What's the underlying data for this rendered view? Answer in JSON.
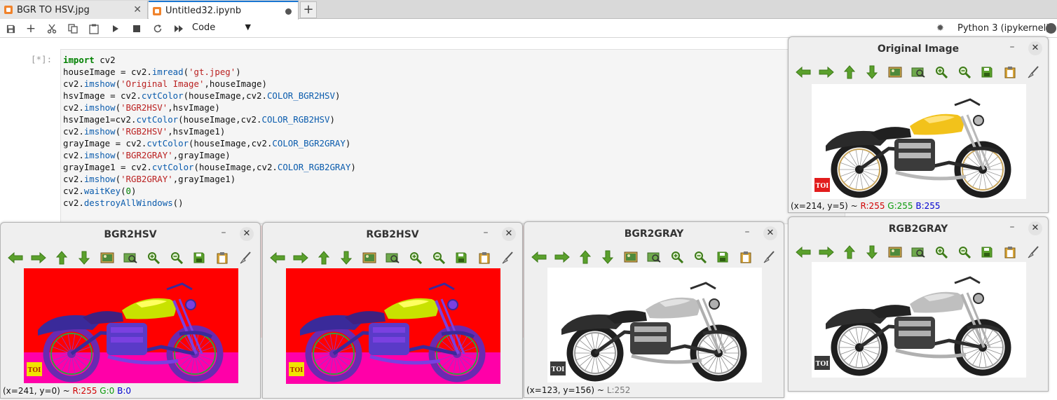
{
  "tabs": [
    {
      "label": "BGR TO HSV.jpg",
      "close": "✕"
    },
    {
      "label": "Untitled32.ipynb"
    }
  ],
  "toolbar": {
    "cell_type": "Code",
    "kernel": "Python 3 (ipykernel)"
  },
  "cell": {
    "prompt": "[*]:",
    "lines": [
      "import cv2",
      "houseImage = cv2.imread('gt.jpeg')",
      "cv2.imshow('Original Image',houseImage)",
      "hsvImage = cv2.cvtColor(houseImage,cv2.COLOR_BGR2HSV)",
      "cv2.imshow('BGR2HSV',hsvImage)",
      "hsvImage1=cv2.cvtColor(houseImage,cv2.COLOR_RGB2HSV)",
      "cv2.imshow('RGB2HSV',hsvImage1)",
      "grayImage = cv2.cvtColor(houseImage,cv2.COLOR_BGR2GRAY)",
      "cv2.imshow('BGR2GRAY',grayImage)",
      "grayImage1 = cv2.cvtColor(houseImage,cv2.COLOR_RGB2GRAY)",
      "cv2.imshow('RGB2GRAY',grayImage1)",
      "cv2.waitKey(0)",
      "cv2.destroyAllWindows()"
    ]
  },
  "windows": {
    "original": {
      "title": "Original Image",
      "status_pos": "(x=214, y=5) ~",
      "status_r": "R:255",
      "status_g": "G:255",
      "status_b": "B:255"
    },
    "bgr2hsv": {
      "title": "BGR2HSV",
      "status_pos": "(x=241, y=0) ~",
      "status_r": "R:255",
      "status_g": "G:0",
      "status_b": "B:0"
    },
    "rgb2hsv": {
      "title": "RGB2HSV"
    },
    "bgr2gray": {
      "title": "BGR2GRAY",
      "status_pos": "(x=123, y=156) ~",
      "status_l": "L:252"
    },
    "rgb2gray": {
      "title": "RGB2GRAY"
    }
  },
  "badge": "TOI",
  "tool_icons": [
    "pan-left-icon",
    "pan-right-icon",
    "pan-up-icon",
    "pan-down-icon",
    "zoom-fit-icon",
    "zoom-original-icon",
    "zoom-in-icon",
    "zoom-out-icon",
    "save-icon",
    "copy-icon",
    "properties-icon"
  ],
  "colors": {
    "hsv_red": "#ff0000",
    "hsv_magenta": "#ff00a8",
    "tab_accent": "#1976d2"
  }
}
